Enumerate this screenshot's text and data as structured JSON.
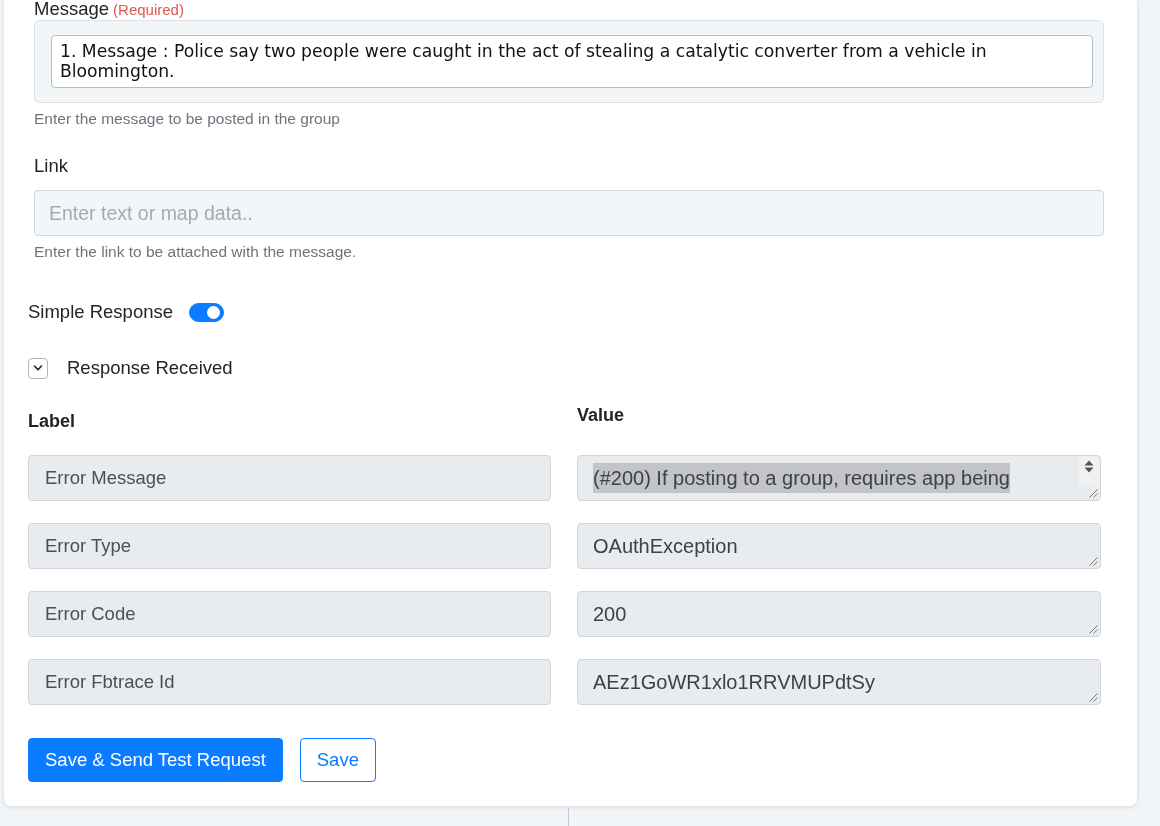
{
  "fields": [
    {
      "kind": "mapped",
      "label": "Message",
      "required_note": "(Required)",
      "value": "1. Message : Police say two people were caught in the act of stealing a catalytic converter from a vehicle in Bloomington.",
      "hint": "Enter the message to be posted in the group"
    },
    {
      "kind": "input",
      "label": "Link",
      "placeholder": "Enter text or map data..",
      "hint": "Enter the link to be attached with the message."
    }
  ],
  "simple_response": {
    "label": "Simple Response",
    "on": true
  },
  "response": {
    "title": "Response Received",
    "expanded": true,
    "columns": [
      "Label",
      "Value"
    ],
    "rows": [
      {
        "label": "Error Message",
        "value": "(#200) If posting to a group, requires app being",
        "text_highlighted": true,
        "scrollable": true
      },
      {
        "label": "Error Type",
        "value": "OAuthException",
        "text_highlighted": false,
        "scrollable": false
      },
      {
        "label": "Error Code",
        "value": "200",
        "text_highlighted": false,
        "scrollable": false
      },
      {
        "label": "Error Fbtrace Id",
        "value": "AEz1GoWR1xlo1RRVMUPdtSy",
        "text_highlighted": false,
        "scrollable": false
      }
    ]
  },
  "buttons": [
    {
      "kind": "primary",
      "label": "Save & Send Test Request"
    },
    {
      "kind": "outline",
      "label": "Save"
    }
  ]
}
